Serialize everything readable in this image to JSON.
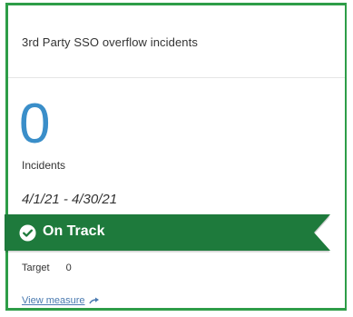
{
  "card": {
    "title": "3rd Party SSO overflow incidents",
    "value": "0",
    "value_label": "Incidents",
    "date_range": "4/1/21 - 4/30/21"
  },
  "status": {
    "label": "On Track",
    "icon": "check-circle-icon",
    "color": "#1e7a3c"
  },
  "target": {
    "label": "Target",
    "value": "0"
  },
  "link": {
    "label": "View measure",
    "icon": "arrow-right-icon"
  },
  "colors": {
    "border": "#2e9d48",
    "value": "#3a8ec9",
    "link": "#4a7ab0"
  }
}
